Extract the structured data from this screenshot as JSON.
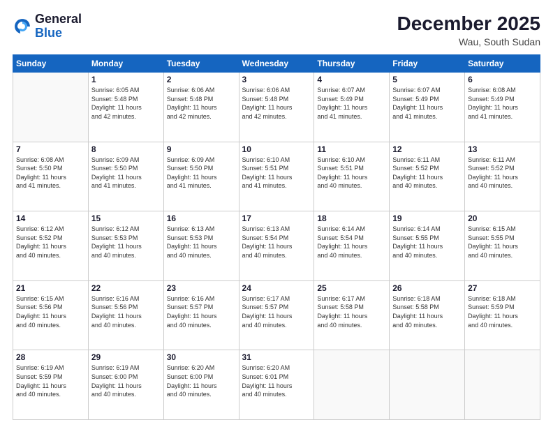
{
  "header": {
    "logo_line1": "General",
    "logo_line2": "Blue",
    "month_year": "December 2025",
    "location": "Wau, South Sudan"
  },
  "days_of_week": [
    "Sunday",
    "Monday",
    "Tuesday",
    "Wednesday",
    "Thursday",
    "Friday",
    "Saturday"
  ],
  "weeks": [
    [
      {
        "day": "",
        "info": ""
      },
      {
        "day": "1",
        "info": "Sunrise: 6:05 AM\nSunset: 5:48 PM\nDaylight: 11 hours\nand 42 minutes."
      },
      {
        "day": "2",
        "info": "Sunrise: 6:06 AM\nSunset: 5:48 PM\nDaylight: 11 hours\nand 42 minutes."
      },
      {
        "day": "3",
        "info": "Sunrise: 6:06 AM\nSunset: 5:48 PM\nDaylight: 11 hours\nand 42 minutes."
      },
      {
        "day": "4",
        "info": "Sunrise: 6:07 AM\nSunset: 5:49 PM\nDaylight: 11 hours\nand 41 minutes."
      },
      {
        "day": "5",
        "info": "Sunrise: 6:07 AM\nSunset: 5:49 PM\nDaylight: 11 hours\nand 41 minutes."
      },
      {
        "day": "6",
        "info": "Sunrise: 6:08 AM\nSunset: 5:49 PM\nDaylight: 11 hours\nand 41 minutes."
      }
    ],
    [
      {
        "day": "7",
        "info": "Sunrise: 6:08 AM\nSunset: 5:50 PM\nDaylight: 11 hours\nand 41 minutes."
      },
      {
        "day": "8",
        "info": "Sunrise: 6:09 AM\nSunset: 5:50 PM\nDaylight: 11 hours\nand 41 minutes."
      },
      {
        "day": "9",
        "info": "Sunrise: 6:09 AM\nSunset: 5:50 PM\nDaylight: 11 hours\nand 41 minutes."
      },
      {
        "day": "10",
        "info": "Sunrise: 6:10 AM\nSunset: 5:51 PM\nDaylight: 11 hours\nand 41 minutes."
      },
      {
        "day": "11",
        "info": "Sunrise: 6:10 AM\nSunset: 5:51 PM\nDaylight: 11 hours\nand 40 minutes."
      },
      {
        "day": "12",
        "info": "Sunrise: 6:11 AM\nSunset: 5:52 PM\nDaylight: 11 hours\nand 40 minutes."
      },
      {
        "day": "13",
        "info": "Sunrise: 6:11 AM\nSunset: 5:52 PM\nDaylight: 11 hours\nand 40 minutes."
      }
    ],
    [
      {
        "day": "14",
        "info": "Sunrise: 6:12 AM\nSunset: 5:52 PM\nDaylight: 11 hours\nand 40 minutes."
      },
      {
        "day": "15",
        "info": "Sunrise: 6:12 AM\nSunset: 5:53 PM\nDaylight: 11 hours\nand 40 minutes."
      },
      {
        "day": "16",
        "info": "Sunrise: 6:13 AM\nSunset: 5:53 PM\nDaylight: 11 hours\nand 40 minutes."
      },
      {
        "day": "17",
        "info": "Sunrise: 6:13 AM\nSunset: 5:54 PM\nDaylight: 11 hours\nand 40 minutes."
      },
      {
        "day": "18",
        "info": "Sunrise: 6:14 AM\nSunset: 5:54 PM\nDaylight: 11 hours\nand 40 minutes."
      },
      {
        "day": "19",
        "info": "Sunrise: 6:14 AM\nSunset: 5:55 PM\nDaylight: 11 hours\nand 40 minutes."
      },
      {
        "day": "20",
        "info": "Sunrise: 6:15 AM\nSunset: 5:55 PM\nDaylight: 11 hours\nand 40 minutes."
      }
    ],
    [
      {
        "day": "21",
        "info": "Sunrise: 6:15 AM\nSunset: 5:56 PM\nDaylight: 11 hours\nand 40 minutes."
      },
      {
        "day": "22",
        "info": "Sunrise: 6:16 AM\nSunset: 5:56 PM\nDaylight: 11 hours\nand 40 minutes."
      },
      {
        "day": "23",
        "info": "Sunrise: 6:16 AM\nSunset: 5:57 PM\nDaylight: 11 hours\nand 40 minutes."
      },
      {
        "day": "24",
        "info": "Sunrise: 6:17 AM\nSunset: 5:57 PM\nDaylight: 11 hours\nand 40 minutes."
      },
      {
        "day": "25",
        "info": "Sunrise: 6:17 AM\nSunset: 5:58 PM\nDaylight: 11 hours\nand 40 minutes."
      },
      {
        "day": "26",
        "info": "Sunrise: 6:18 AM\nSunset: 5:58 PM\nDaylight: 11 hours\nand 40 minutes."
      },
      {
        "day": "27",
        "info": "Sunrise: 6:18 AM\nSunset: 5:59 PM\nDaylight: 11 hours\nand 40 minutes."
      }
    ],
    [
      {
        "day": "28",
        "info": "Sunrise: 6:19 AM\nSunset: 5:59 PM\nDaylight: 11 hours\nand 40 minutes."
      },
      {
        "day": "29",
        "info": "Sunrise: 6:19 AM\nSunset: 6:00 PM\nDaylight: 11 hours\nand 40 minutes."
      },
      {
        "day": "30",
        "info": "Sunrise: 6:20 AM\nSunset: 6:00 PM\nDaylight: 11 hours\nand 40 minutes."
      },
      {
        "day": "31",
        "info": "Sunrise: 6:20 AM\nSunset: 6:01 PM\nDaylight: 11 hours\nand 40 minutes."
      },
      {
        "day": "",
        "info": ""
      },
      {
        "day": "",
        "info": ""
      },
      {
        "day": "",
        "info": ""
      }
    ]
  ]
}
